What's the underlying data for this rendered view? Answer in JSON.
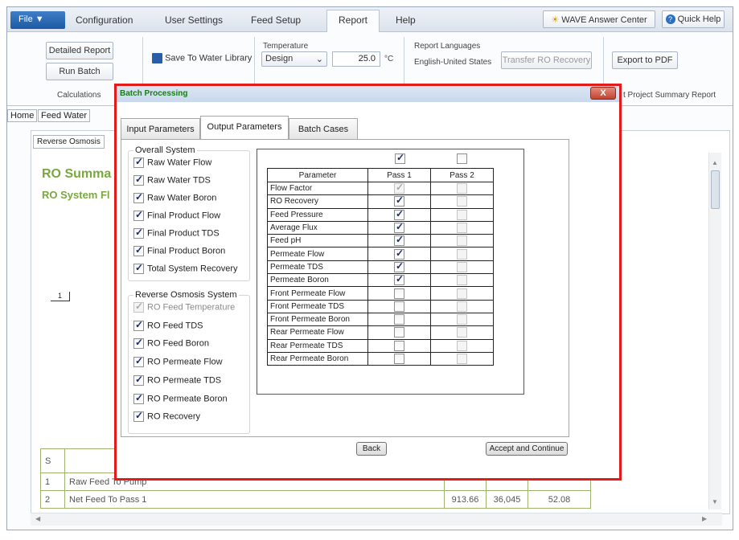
{
  "menubar": {
    "file_label": "File ▼",
    "items": [
      "Configuration",
      "User Settings",
      "Feed Setup",
      "Report",
      "Help"
    ],
    "answer_center": "WAVE Answer Center",
    "quick_help": "Quick Help"
  },
  "ribbon": {
    "detailed_report": "Detailed Report",
    "run_batch": "Run Batch",
    "calculations": "Calculations",
    "save_library": "Save To Water Library",
    "temperature_label": "Temperature",
    "temperature_mode": "Design",
    "temperature_value": "25.0",
    "temperature_unit": "°C",
    "report_languages_label": "Report Languages",
    "report_language_value": "English-United States",
    "transfer_ro": "Transfer RO Recovery",
    "export_pdf": "Export to PDF",
    "project_summary": "t Project Summary Report"
  },
  "subtabs": [
    "Home",
    "Feed Water"
  ],
  "content": {
    "tab_label": "Reverse Osmosis",
    "heading": "RO Summa",
    "subheading": "RO System Fl",
    "diagram_label": "1",
    "table_header_num": "S",
    "rows": [
      {
        "num": "1",
        "name": "Raw Feed To Pump",
        "v1": "",
        "v2": "",
        "v3": ""
      },
      {
        "num": "2",
        "name": "Net Feed To Pass 1",
        "v1": "913.66",
        "v2": "36,045",
        "v3": "52.08"
      }
    ]
  },
  "dialog": {
    "title": "Batch Processing",
    "close": "X",
    "tabs": [
      "Input Parameters",
      "Output Parameters",
      "Batch Cases"
    ],
    "overall_title": "Overall System",
    "overall": [
      {
        "label": "Raw Water Flow",
        "checked": true
      },
      {
        "label": "Raw Water TDS",
        "checked": true
      },
      {
        "label": "Raw Water Boron",
        "checked": true
      },
      {
        "label": "Final Product Flow",
        "checked": true
      },
      {
        "label": "Final Product TDS",
        "checked": true
      },
      {
        "label": "Final Product Boron",
        "checked": true
      },
      {
        "label": "Total System Recovery",
        "checked": true
      }
    ],
    "ro_title": "Reverse Osmosis System",
    "ro": [
      {
        "label": "RO Feed Temperature",
        "checked": true,
        "disabled": true
      },
      {
        "label": "RO Feed TDS",
        "checked": true
      },
      {
        "label": "RO Feed Boron",
        "checked": true
      },
      {
        "label": "RO Permeate Flow",
        "checked": true
      },
      {
        "label": "RO Permeate TDS",
        "checked": true
      },
      {
        "label": "RO Permeate Boron",
        "checked": true
      },
      {
        "label": "RO Recovery",
        "checked": true
      }
    ],
    "table": {
      "headers": [
        "Parameter",
        "Pass 1",
        "Pass 2"
      ],
      "pass1_all": true,
      "pass2_all": false,
      "rows": [
        {
          "param": "Flow Factor",
          "p1": true,
          "p1_disabled": true,
          "p2": false
        },
        {
          "param": "RO Recovery",
          "p1": true,
          "p2": false
        },
        {
          "param": "Feed Pressure",
          "p1": true,
          "p2": false
        },
        {
          "param": "Average Flux",
          "p1": true,
          "p2": false
        },
        {
          "param": "Feed pH",
          "p1": true,
          "p2": false
        },
        {
          "param": "Permeate Flow",
          "p1": true,
          "p2": false
        },
        {
          "param": "Permeate TDS",
          "p1": true,
          "p2": false
        },
        {
          "param": "Permeate Boron",
          "p1": true,
          "p2": false
        },
        {
          "param": "Front Permeate Flow",
          "p1": false,
          "p2": false
        },
        {
          "param": "Front Permeate TDS",
          "p1": false,
          "p2": false
        },
        {
          "param": "Front Permeate Boron",
          "p1": false,
          "p2": false
        },
        {
          "param": "Rear Permeate Flow",
          "p1": false,
          "p2": false
        },
        {
          "param": "Rear Permeate TDS",
          "p1": false,
          "p2": false
        },
        {
          "param": "Rear Permeate Boron",
          "p1": false,
          "p2": false
        }
      ]
    },
    "back": "Back",
    "accept": "Accept and Continue"
  },
  "colors": {
    "highlight": "#e31b1b",
    "heading_green": "#79a83e",
    "dialog_title": "#1a7a1a"
  }
}
